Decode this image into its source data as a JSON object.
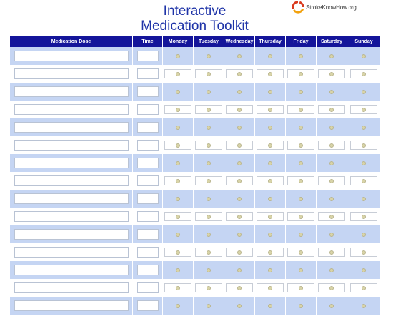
{
  "header": {
    "title_line1": "Interactive",
    "title_line2": "Medication Toolkit",
    "logo_text": "StrokeKnowHow.org"
  },
  "colors": {
    "title": "#1f34a8",
    "header_bar": "#14159a",
    "row_alt": "#c5d5f3",
    "logo_red": "#d93a1e",
    "logo_orange": "#f2a20f"
  },
  "table": {
    "columns": [
      "Medication Dose",
      "Time",
      "Monday",
      "Tuesday",
      "Wednesday",
      "Thursday",
      "Friday",
      "Saturday",
      "Sunday"
    ],
    "day_columns": [
      "Monday",
      "Tuesday",
      "Wednesday",
      "Thursday",
      "Friday",
      "Saturday",
      "Sunday"
    ],
    "rows": [
      {
        "dose": "",
        "time": ""
      },
      {
        "dose": "",
        "time": ""
      },
      {
        "dose": "",
        "time": ""
      },
      {
        "dose": "",
        "time": ""
      },
      {
        "dose": "",
        "time": ""
      },
      {
        "dose": "",
        "time": ""
      },
      {
        "dose": "",
        "time": ""
      },
      {
        "dose": "",
        "time": ""
      },
      {
        "dose": "",
        "time": ""
      },
      {
        "dose": "",
        "time": ""
      },
      {
        "dose": "",
        "time": ""
      },
      {
        "dose": "",
        "time": ""
      },
      {
        "dose": "",
        "time": ""
      },
      {
        "dose": "",
        "time": ""
      },
      {
        "dose": "",
        "time": ""
      }
    ]
  }
}
